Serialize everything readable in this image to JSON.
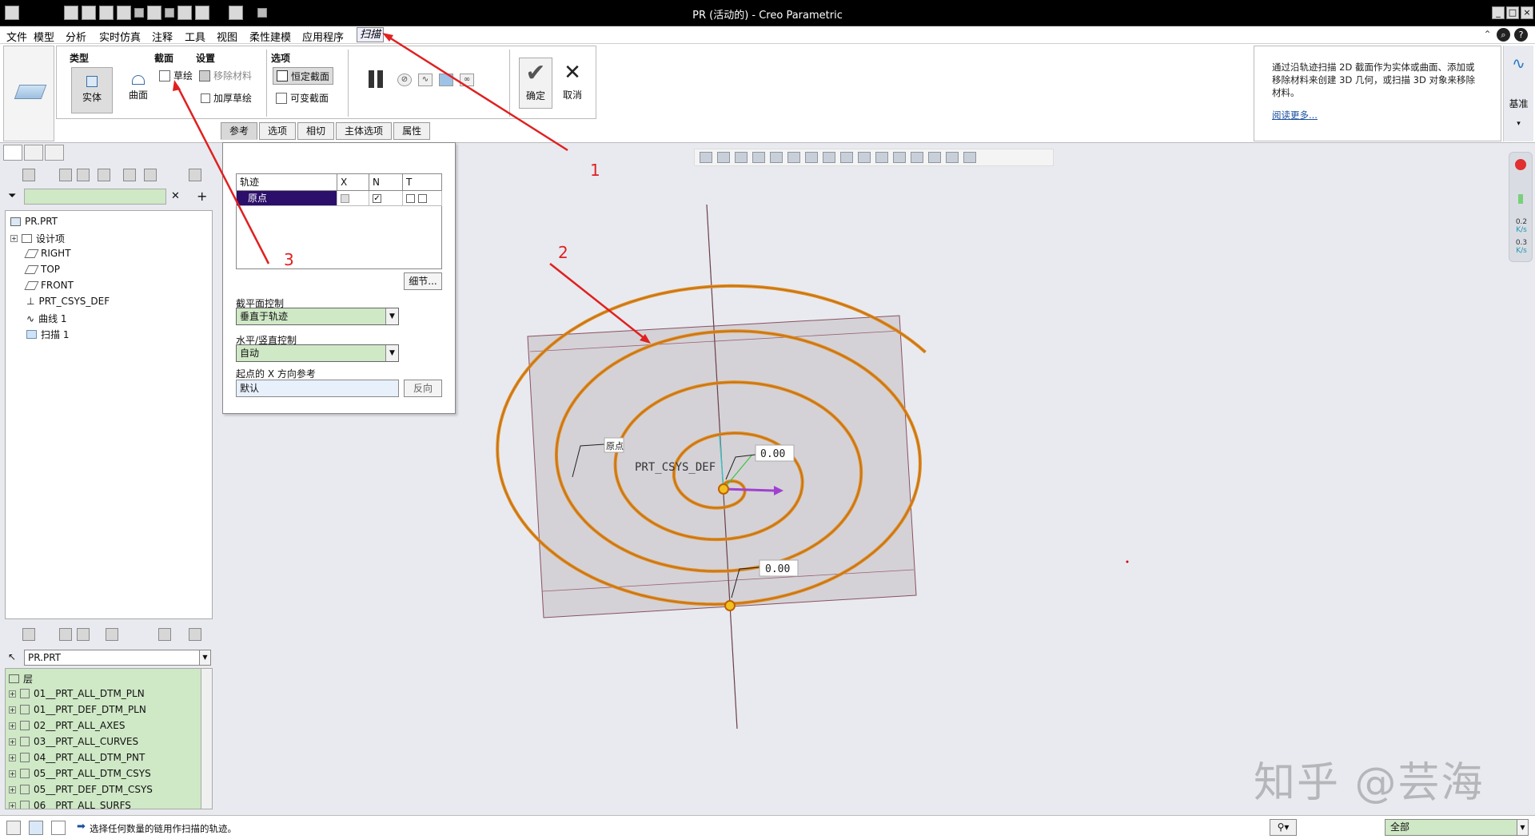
{
  "window": {
    "title": "PR (活动的) - Creo Parametric"
  },
  "menu": {
    "items": [
      "文件",
      "模型",
      "分析",
      "实时仿真",
      "注释",
      "工具",
      "视图",
      "柔性建模",
      "应用程序"
    ],
    "active_tab": "扫描"
  },
  "ribbon": {
    "group_type": "类型",
    "solid": "实体",
    "surface": "曲面",
    "group_section": "截面",
    "sketch": "草绘",
    "group_settings": "设置",
    "remove_material": "移除材料",
    "thicken_sketch": "加厚草绘",
    "group_options": "选项",
    "constant_section": "恒定截面",
    "variable_section": "可变截面",
    "ok": "确定",
    "cancel": "取消",
    "datum": "基准"
  },
  "help": {
    "text": "通过沿轨迹扫描 2D 截面作为实体或曲面、添加或移除材料来创建 3D 几何，或扫描 3D 对象来移除材料。",
    "link": "阅读更多..."
  },
  "dashboard_tabs": [
    "参考",
    "选项",
    "相切",
    "主体选项",
    "属性"
  ],
  "references_panel": {
    "columns": [
      "轨迹",
      "X",
      "N",
      "T"
    ],
    "rows": [
      {
        "name": "原点",
        "x": false,
        "n": true,
        "t": false
      }
    ],
    "details_button": "细节...",
    "section_plane_label": "截平面控制",
    "section_plane_value": "垂直于轨迹",
    "hv_control_label": "水平/竖直控制",
    "hv_control_value": "自动",
    "x_ref_label": "起点的 X 方向参考",
    "x_ref_value": "默认",
    "flip_button": "反向"
  },
  "model_tree": {
    "items": [
      "PR.PRT",
      "设计项",
      "RIGHT",
      "TOP",
      "FRONT",
      "PRT_CSYS_DEF",
      "曲线 1",
      "扫描 1"
    ]
  },
  "layers": {
    "selector": "PR.PRT",
    "header": "层",
    "items": [
      "01__PRT_ALL_DTM_PLN",
      "01__PRT_DEF_DTM_PLN",
      "02__PRT_ALL_AXES",
      "03__PRT_ALL_CURVES",
      "04__PRT_ALL_DTM_PNT",
      "05__PRT_ALL_DTM_CSYS",
      "05__PRT_DEF_DTM_CSYS",
      "06__PRT_ALL_SURFS"
    ]
  },
  "graphics": {
    "csys_label": "PRT_CSYS_DEF",
    "origin_label": "原点",
    "dim1": "0.00",
    "dim2": "0.00"
  },
  "annotations": [
    "1",
    "2",
    "3"
  ],
  "side_readouts": [
    "0.2",
    "K/s",
    "0.3",
    "K/s"
  ],
  "status": {
    "message": "选择任何数量的链用作扫描的轨迹。",
    "filter": "全部"
  },
  "watermark": "知乎 @芸海"
}
